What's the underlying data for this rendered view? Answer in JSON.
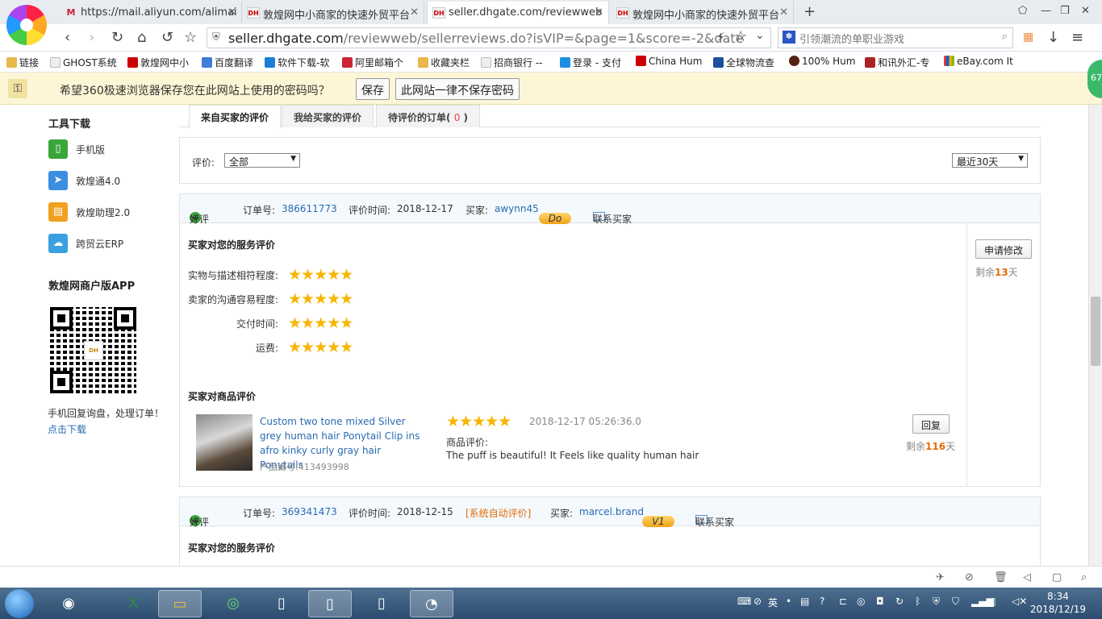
{
  "browser": {
    "tabs": [
      {
        "label": "https://mail.aliyun.com/alimai",
        "favicon": "M"
      },
      {
        "label": "敦煌网中小商家的快速外贸平台",
        "favicon": "DH"
      },
      {
        "label": "seller.dhgate.com/reviewweb",
        "favicon": "DH"
      },
      {
        "label": "敦煌网中小商家的快速外贸平台",
        "favicon": "DH"
      }
    ],
    "new_tab": "+",
    "url_host": "seller.dhgate.com",
    "url_rest": "/reviewweb/sellerreviews.do?isVIP=&page=1&score=-2&date",
    "search_placeholder": "引领潮流的单职业游戏"
  },
  "bookmarks": [
    {
      "label": "链接",
      "color": "#e8b84a"
    },
    {
      "label": "GHOST系统",
      "color": "#ddd"
    },
    {
      "label": "敦煌网中小",
      "color": "#c00"
    },
    {
      "label": "百度翻译",
      "color": "#3e7dd8"
    },
    {
      "label": "软件下载-软",
      "color": "#1b7fd6"
    },
    {
      "label": "阿里邮箱个",
      "color": "#c23"
    },
    {
      "label": "收藏夹栏",
      "color": "#e8b84a"
    },
    {
      "label": "招商银行 --",
      "color": "#ddd"
    },
    {
      "label": "登录 - 支付",
      "color": "#1a8fe3"
    },
    {
      "label": "China Hum",
      "color": "#c00"
    },
    {
      "label": "全球物流查",
      "color": "#1d4fa0"
    },
    {
      "label": "100% Hum",
      "color": "#552211"
    },
    {
      "label": "和讯外汇-专",
      "color": "#a22"
    },
    {
      "label": "eBay.com It",
      "color": "#e53238"
    }
  ],
  "password_bar": {
    "message": "希望360极速浏览器保存您在此网站上使用的密码吗？",
    "save": "保存",
    "never": "此网站一律不保存密码"
  },
  "sidebar": {
    "tools_title": "工具下载",
    "tools": [
      {
        "label": "手机版",
        "icon": "phone-icon",
        "color": "#3aa63a"
      },
      {
        "label": "敦煌通4.0",
        "icon": "paper-plane-icon",
        "color": "#3b8fe0"
      },
      {
        "label": "敦煌助理2.0",
        "icon": "briefcase-icon",
        "color": "#f0a020"
      },
      {
        "label": "跨贸云ERP",
        "icon": "cloud-icon",
        "color": "#3aa0e0"
      }
    ],
    "app_title": "敦煌网商户版APP",
    "app_desc": "手机回复询盘，处理订单！",
    "app_link": "点击下载"
  },
  "review_tabs": {
    "from_buyers": "来自买家的评价",
    "to_buyers": "我给买家的评价",
    "pending_prefix": "待评价的订单(",
    "pending_count": "0",
    "pending_suffix": ")"
  },
  "filter": {
    "label": "评价:",
    "rating_value": "全部",
    "period_value": "最近30天"
  },
  "labels": {
    "order_no": "订单号:",
    "review_time": "评价时间:",
    "buyer": "买家:",
    "contact": "联系买家",
    "service_title": "买家对您的服务评价",
    "product_title": "买家对商品评价",
    "product_review": "商品评价:",
    "request_change": "申请修改",
    "reply": "回复",
    "remain_prefix": "剩余",
    "remain_suffix": "天",
    "product_id_prefix": "产品编号:"
  },
  "reviews": [
    {
      "type": "好评",
      "order_no": "386611773",
      "review_date": "2018-12-17",
      "buyer": "awynn45",
      "buyer_level": "Do",
      "ratings": [
        {
          "label": "实物与描述相符程度:",
          "stars": 5
        },
        {
          "label": "卖家的沟通容易程度:",
          "stars": 5
        },
        {
          "label": "交付时间:",
          "stars": 5
        },
        {
          "label": "运费:",
          "stars": 5
        }
      ],
      "remain_days": "13",
      "product": {
        "title": "Custom two tone mixed Silver grey human hair Ponytail Clip ins afro kinky curly gray hair Ponytails",
        "product_id": "413493998",
        "stars": 5,
        "time": "2018-12-17 05:26:36.0",
        "review": "The puff is beautiful! It Feels like quality human hair",
        "remain_days": "116"
      }
    },
    {
      "type": "好评",
      "order_no": "369341473",
      "review_date": "2018-12-15",
      "auto_tag": "[系统自动评价]",
      "buyer": "marcel.brand",
      "buyer_level": "V1"
    }
  ],
  "statusbar": {
    "zoom": ""
  },
  "taskbar": {
    "time": "8:34",
    "date": "2018/12/19",
    "ime": "英"
  },
  "side_badge": "67"
}
